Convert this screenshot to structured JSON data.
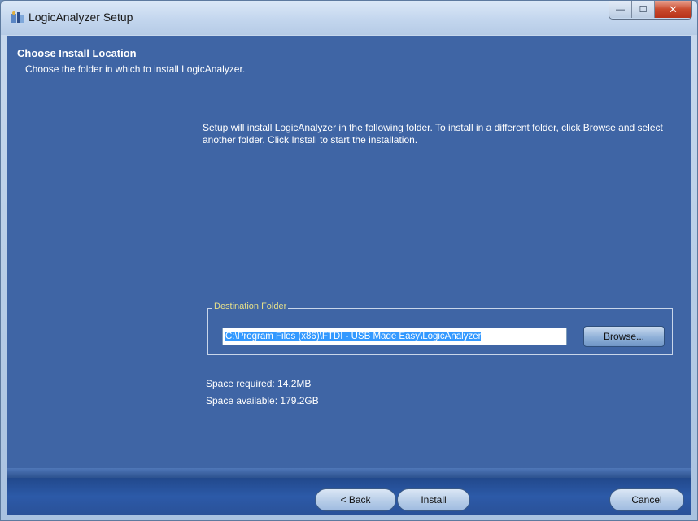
{
  "window": {
    "title": "LogicAnalyzer Setup",
    "controls": {
      "minimize": "—",
      "maximize": "☐",
      "close": "✕"
    }
  },
  "header": {
    "title": "Choose Install Location",
    "subtitle": "Choose the folder in which to install LogicAnalyzer."
  },
  "intro_text": "Setup will install LogicAnalyzer in the following folder. To install in a different folder, click Browse and select another folder. Click Install to start the installation.",
  "destination": {
    "legend": "Destination Folder",
    "path": "C:\\Program Files (x86)\\FTDI - USB Made Easy\\LogicAnalyzer",
    "browse_label": "Browse..."
  },
  "space": {
    "required": "Space required: 14.2MB",
    "available": "Space available: 179.2GB"
  },
  "footer": {
    "back_label": "< Back",
    "install_label": "Install",
    "cancel_label": "Cancel"
  },
  "icons": {
    "app": "installer-icon"
  },
  "colors": {
    "accent": "#3f65a5",
    "legend": "#e6e08a",
    "selection": "#3399ff"
  }
}
